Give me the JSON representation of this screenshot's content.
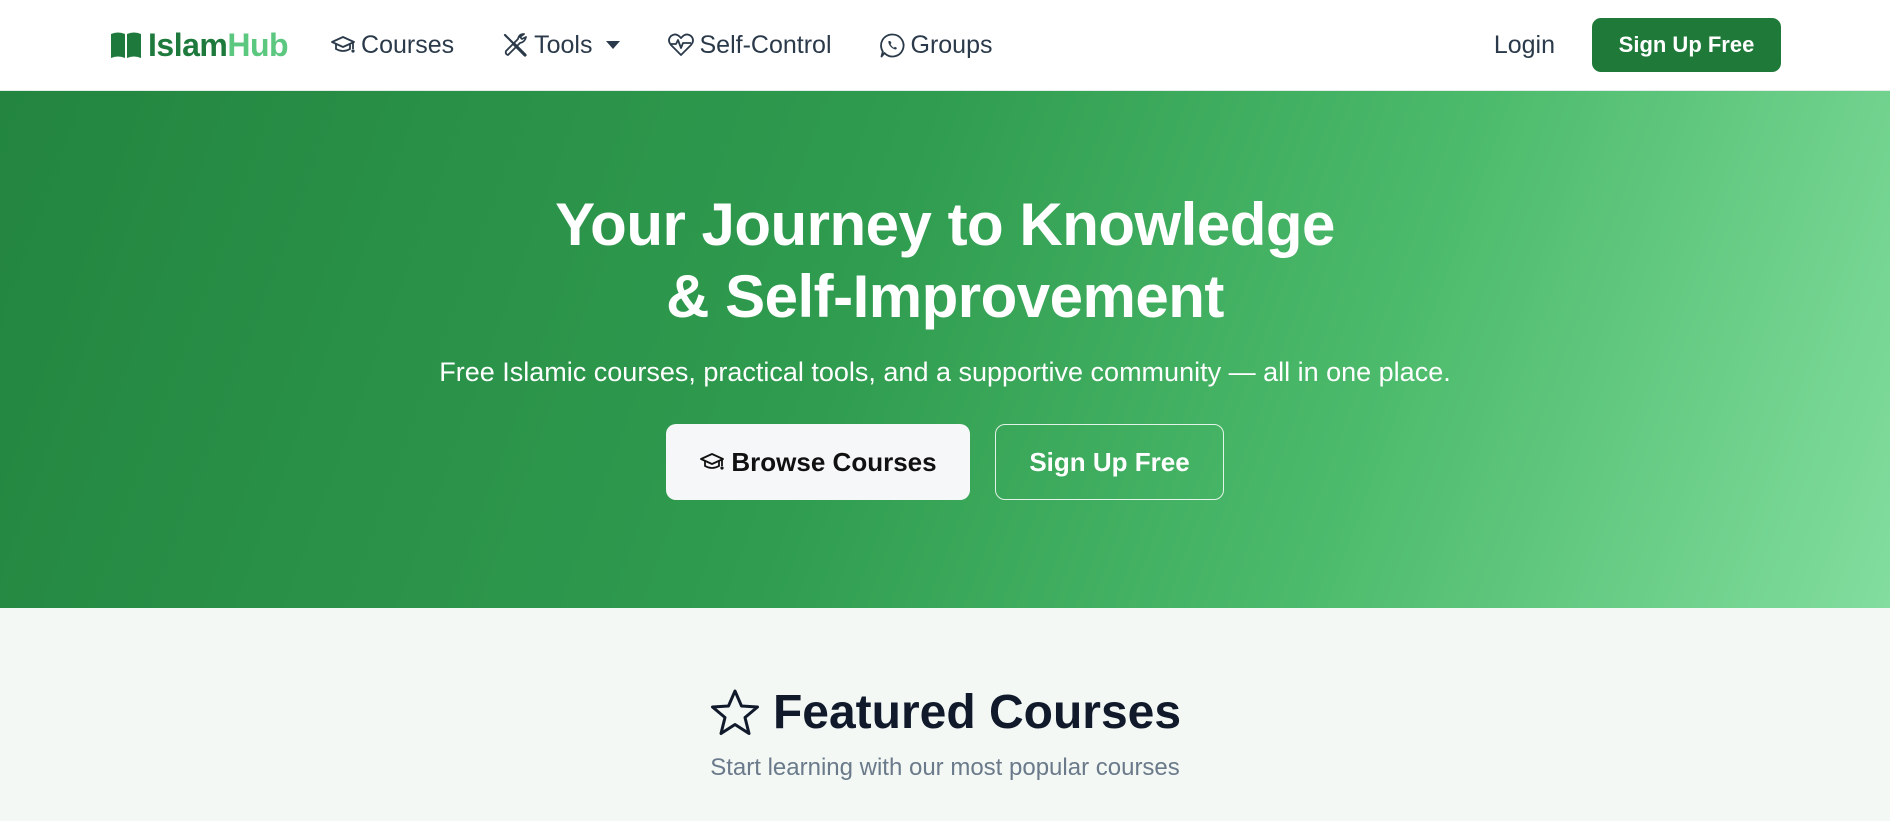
{
  "nav": {
    "brand_part1": "Islam",
    "brand_part2": "Hub",
    "links": [
      {
        "label": "Courses",
        "icon": "graduation-cap-icon"
      },
      {
        "label": "Tools",
        "icon": "tools-icon",
        "dropdown": true
      },
      {
        "label": "Self-Control",
        "icon": "heart-pulse-icon"
      },
      {
        "label": "Groups",
        "icon": "whatsapp-icon"
      }
    ],
    "login": "Login",
    "signup": "Sign Up Free"
  },
  "hero": {
    "title_line1": "Your Journey to Knowledge",
    "title_line2": "& Self-Improvement",
    "subtitle": "Free Islamic courses, practical tools, and a supportive community — all in one place.",
    "browse_button": "Browse Courses",
    "signup_button": "Sign Up Free"
  },
  "featured": {
    "title": "Featured Courses",
    "subtitle": "Start learning with our most popular courses"
  },
  "colors": {
    "brand_dark": "#1e7a3c",
    "brand_light": "#5bc77f",
    "signup_button_bg": "#1f7a3a",
    "hero_gradient_start": "#238540",
    "hero_gradient_end": "#82dd9e"
  }
}
